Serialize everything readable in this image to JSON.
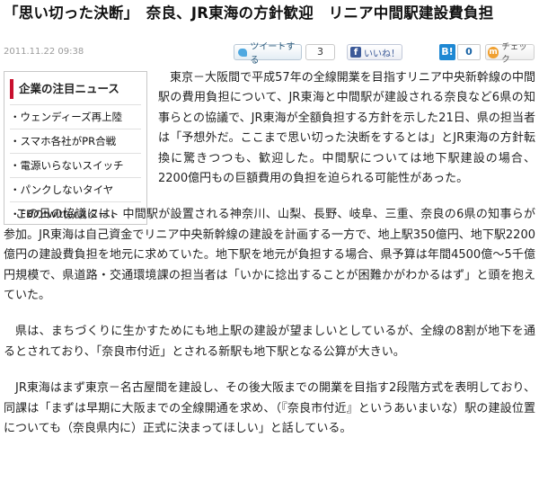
{
  "article": {
    "headline": "「思い切った決断」　奈良、JR東海の方針歓迎　リニア中間駅建設費負担",
    "date": "2011.11.22 09:38"
  },
  "social": {
    "tweet_label": "ツイートする",
    "tweet_count": "3",
    "like_label": "いいね！",
    "hatena_logo": "B!",
    "hatena_count": "0",
    "mixi_logo": "m",
    "check_label": "チェック"
  },
  "sidebar": {
    "title": "企業の注目ニュース",
    "items": [
      {
        "label": "・ウェンディーズ再上陸"
      },
      {
        "label": "・スマホ各社がPR合戦"
      },
      {
        "label": "・電源いらないスイッチ"
      },
      {
        "label": "・パンクしないタイヤ"
      },
      {
        "label": "・FBのtwitterスタート"
      }
    ]
  },
  "paragraphs": [
    "東京－大阪間で平成57年の全線開業を目指すリニア中央新幹線の中間駅の費用負担について、JR東海と中間駅が建設される奈良など6県の知事らとの協議で、JR東海が全額負担する方針を示した21日、県の担当者は「予想外だ。ここまで思い切った決断をするとは」とJR東海の方針転換に驚きつつも、歓迎した。中間駅については地下駅建設の場合、2200億円もの巨額費用の負担を迫られる可能性があった。",
    "この日の協議には、中間駅が設置される神奈川、山梨、長野、岐阜、三重、奈良の6県の知事らが参加。JR東海は自己資金でリニア中央新幹線の建設を計画する一方で、地上駅350億円、地下駅2200億円の建設費負担を地元に求めていた。地下駅を地元が負担する場合、県予算は年間4500億～5千億円規模で、県道路・交通環境課の担当者は「いかに捻出することが困難かがわかるはず」と頭を抱えていた。",
    "県は、まちづくりに生かすためにも地上駅の建設が望ましいとしているが、全線の8割が地下を通るとされており、「奈良市付近」とされる新駅も地下駅となる公算が大きい。",
    "JR東海はまず東京－名古屋間を建設し、その後大阪までの開業を目指す2段階方式を表明しており、同課は「まずは早期に大阪までの全線開通を求め、（『奈良市付近』というあいまいな）駅の建設位置についても（奈良県内に）正式に決まってほしい」と話している。"
  ],
  "colors": {
    "sidebar_accent": "#c8102e",
    "date_text": "#9a9a9a"
  }
}
